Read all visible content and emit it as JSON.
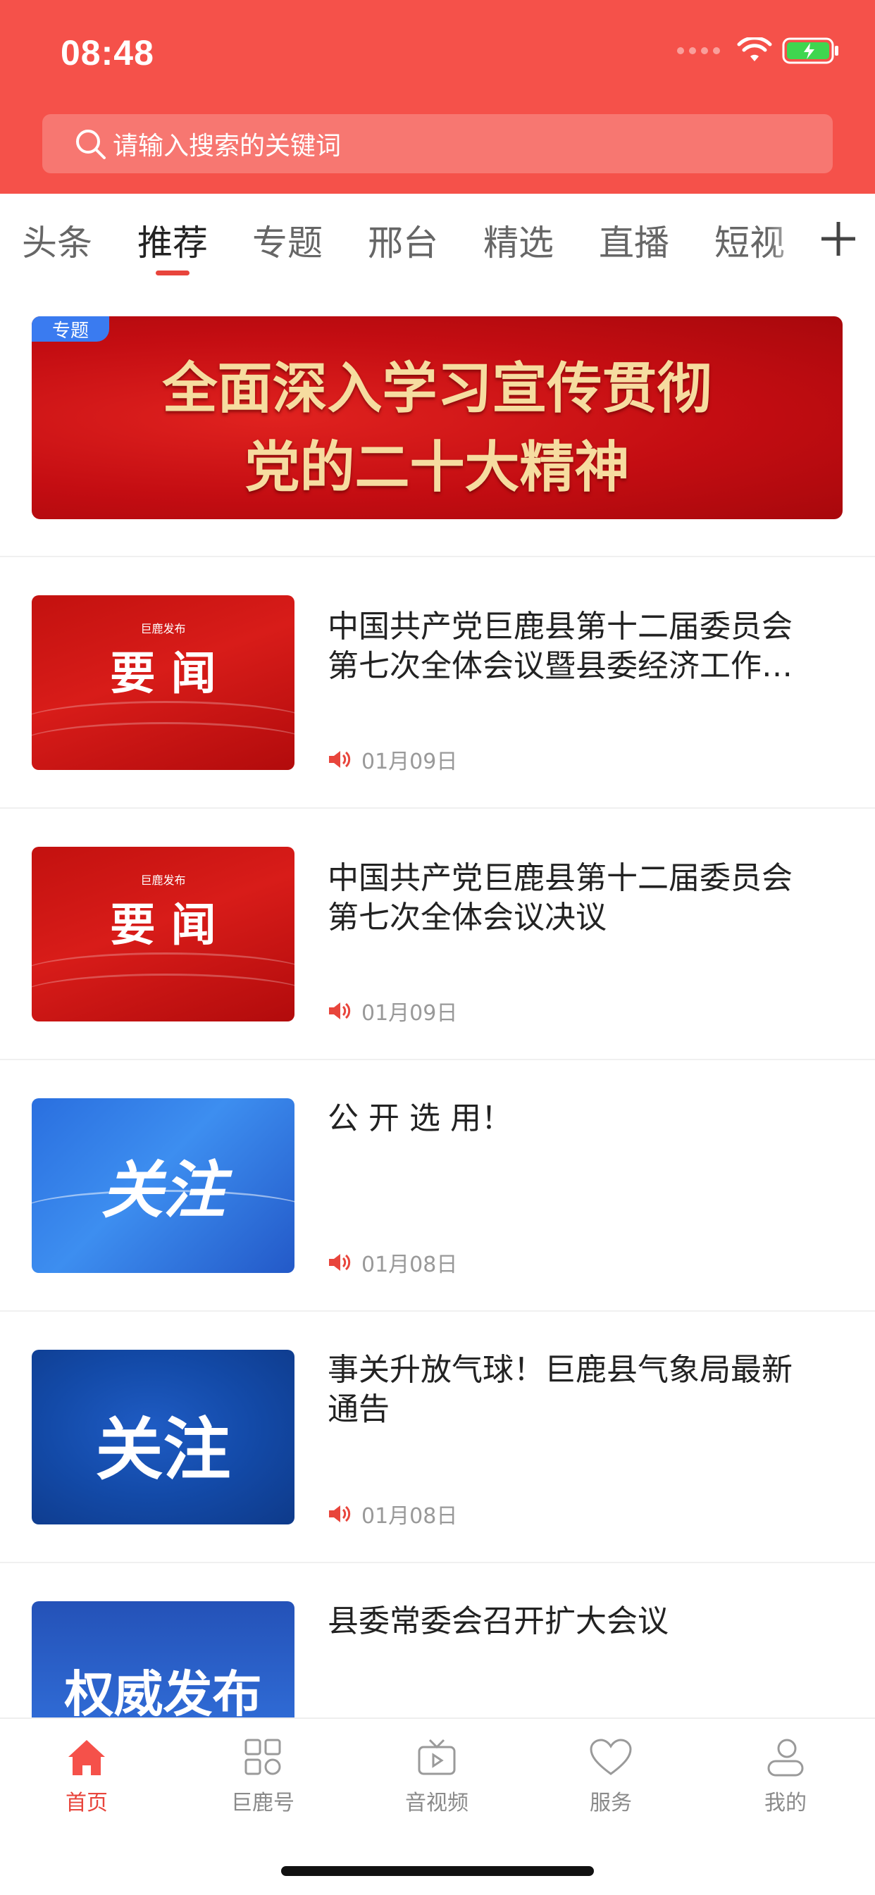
{
  "status_bar": {
    "time": "08:48"
  },
  "search": {
    "placeholder": "请输入搜索的关键词"
  },
  "tabs": [
    {
      "label": "头条"
    },
    {
      "label": "推荐",
      "active": true
    },
    {
      "label": "专题"
    },
    {
      "label": "邢台"
    },
    {
      "label": "精选"
    },
    {
      "label": "直播"
    },
    {
      "label": "短视"
    }
  ],
  "banner": {
    "badge": "专题",
    "line1": "全面深入学习宣传贯彻",
    "line2": "党的二十大精神"
  },
  "news": [
    {
      "thumb_small": "巨鹿发布",
      "thumb_big": "要 闻",
      "title_lines": [
        "中国共产党巨鹿县第十二届委员会",
        "第七次全体会议暨县委经济工作…"
      ],
      "date": "01月09日"
    },
    {
      "thumb_small": "巨鹿发布",
      "thumb_big": "要 闻",
      "title_lines": [
        "中国共产党巨鹿县第十二届委员会",
        "第七次全体会议决议"
      ],
      "date": "01月09日"
    },
    {
      "thumb_big": "关注",
      "title_lines": [
        "公 开 选 用！"
      ],
      "date": "01月08日"
    },
    {
      "thumb_big": "关注",
      "title_lines": [
        "事关升放气球！巨鹿县气象局最新",
        "通告"
      ],
      "date": "01月08日"
    },
    {
      "thumb_big": "权威发布",
      "title_lines": [
        "县委常委会召开扩大会议"
      ]
    }
  ],
  "bottom_nav": [
    {
      "label": "首页",
      "icon": "home-icon",
      "active": true
    },
    {
      "label": "巨鹿号",
      "icon": "grid-icon"
    },
    {
      "label": "音视频",
      "icon": "tv-icon"
    },
    {
      "label": "服务",
      "icon": "heart-icon"
    },
    {
      "label": "我的",
      "icon": "person-icon"
    }
  ],
  "colors": {
    "brand": "#f5514a",
    "accent": "#e8453c",
    "badge": "#3a7bf0"
  }
}
